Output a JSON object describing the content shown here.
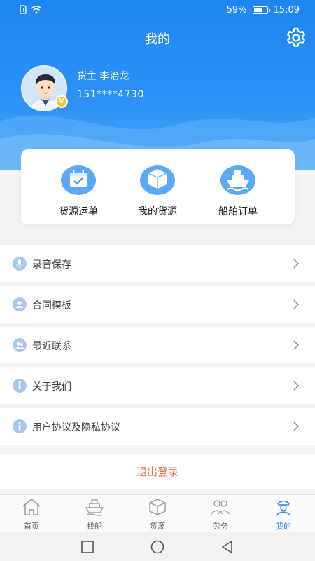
{
  "status_bar": {
    "battery_pct": "59%",
    "time": "15:09",
    "sim_icon": "sim-alert-icon",
    "wifi_icon": "wifi-icon"
  },
  "header": {
    "title": "我的",
    "settings_icon": "gear-icon"
  },
  "profile": {
    "name": "货主 李治龙",
    "phone": "151****4730",
    "badge": "V"
  },
  "quick_actions": [
    {
      "label": "货源运单",
      "icon": "calendar-check-icon"
    },
    {
      "label": "我的货源",
      "icon": "box-icon"
    },
    {
      "label": "船舶订单",
      "icon": "ship-icon"
    }
  ],
  "menu": [
    {
      "label": "录音保存",
      "icon": "microphone-icon"
    },
    {
      "label": "合同模板",
      "icon": "person-icon"
    },
    {
      "label": "最近联系",
      "icon": "contacts-icon"
    },
    {
      "label": "关于我们",
      "icon": "info-icon"
    },
    {
      "label": "用户协议及隐私协议",
      "icon": "info-icon"
    }
  ],
  "logout_label": "退出登录",
  "bottom_nav": [
    {
      "label": "首页",
      "icon": "home-icon"
    },
    {
      "label": "找船",
      "icon": "ship-icon"
    },
    {
      "label": "货源",
      "icon": "box-icon"
    },
    {
      "label": "劳务",
      "icon": "people-icon"
    },
    {
      "label": "我的",
      "icon": "captain-icon",
      "active": true
    }
  ],
  "colors": {
    "primary": "#2a8bf2",
    "logout": "#e07852",
    "badge": "#f2c230"
  }
}
